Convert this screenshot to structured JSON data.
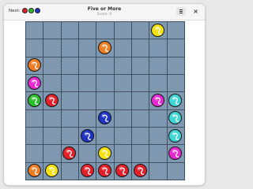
{
  "window": {
    "title": "Five or More",
    "subtitle": "Score: 0"
  },
  "header": {
    "next_label": "Next:",
    "next_balls": [
      "red",
      "green",
      "blue"
    ]
  },
  "menu_icon": "hamburger-menu-icon",
  "close_icon": "close-icon",
  "colors": {
    "red": "#e3202a",
    "green": "#2bbf2d",
    "blue": "#1f34c6",
    "orange": "#ee7d22",
    "yellow": "#f4e10f",
    "magenta": "#e52ad0",
    "cyan": "#3fd6d6"
  },
  "board": {
    "rows": 9,
    "cols": 9,
    "balls": [
      {
        "row": 0,
        "col": 7,
        "color": "yellow"
      },
      {
        "row": 1,
        "col": 4,
        "color": "orange"
      },
      {
        "row": 2,
        "col": 0,
        "color": "orange"
      },
      {
        "row": 3,
        "col": 0,
        "color": "magenta"
      },
      {
        "row": 4,
        "col": 0,
        "color": "green"
      },
      {
        "row": 4,
        "col": 1,
        "color": "red"
      },
      {
        "row": 4,
        "col": 7,
        "color": "magenta"
      },
      {
        "row": 4,
        "col": 8,
        "color": "cyan"
      },
      {
        "row": 5,
        "col": 4,
        "color": "blue"
      },
      {
        "row": 5,
        "col": 8,
        "color": "cyan"
      },
      {
        "row": 6,
        "col": 3,
        "color": "blue"
      },
      {
        "row": 6,
        "col": 8,
        "color": "cyan"
      },
      {
        "row": 7,
        "col": 2,
        "color": "red"
      },
      {
        "row": 7,
        "col": 4,
        "color": "yellow"
      },
      {
        "row": 7,
        "col": 8,
        "color": "magenta"
      },
      {
        "row": 8,
        "col": 0,
        "color": "orange"
      },
      {
        "row": 8,
        "col": 1,
        "color": "yellow"
      },
      {
        "row": 8,
        "col": 3,
        "color": "red"
      },
      {
        "row": 8,
        "col": 4,
        "color": "red"
      },
      {
        "row": 8,
        "col": 5,
        "color": "red"
      },
      {
        "row": 8,
        "col": 6,
        "color": "red"
      }
    ]
  }
}
